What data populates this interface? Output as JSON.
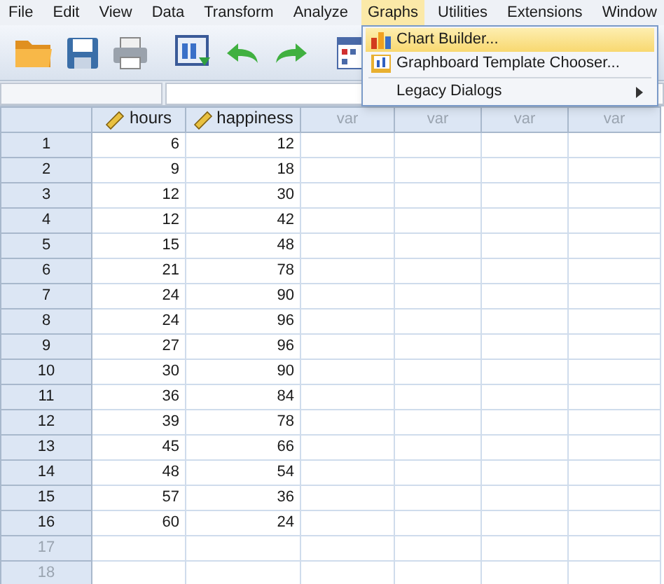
{
  "menu_bar": [
    {
      "label": "File",
      "selected": false
    },
    {
      "label": "Edit",
      "selected": false
    },
    {
      "label": "View",
      "selected": false
    },
    {
      "label": "Data",
      "selected": false
    },
    {
      "label": "Transform",
      "selected": false
    },
    {
      "label": "Analyze",
      "selected": false
    },
    {
      "label": "Graphs",
      "selected": true
    },
    {
      "label": "Utilities",
      "selected": false
    },
    {
      "label": "Extensions",
      "selected": false
    },
    {
      "label": "Window",
      "selected": false
    }
  ],
  "graphs_menu": {
    "items": [
      {
        "label": "Chart Builder...",
        "kind": "chart",
        "selected": true
      },
      {
        "label": "Graphboard Template Chooser...",
        "kind": "graphboard",
        "selected": false
      },
      {
        "label": "Legacy Dialogs",
        "kind": "submenu",
        "selected": false
      }
    ]
  },
  "table": {
    "columns": [
      {
        "label": "hours",
        "kind": "numeric"
      },
      {
        "label": "happiness",
        "kind": "numeric"
      },
      {
        "label": "var",
        "kind": "empty"
      },
      {
        "label": "var",
        "kind": "empty"
      },
      {
        "label": "var",
        "kind": "empty"
      },
      {
        "label": "var",
        "kind": "empty"
      }
    ],
    "rows": [
      {
        "number": "1",
        "in_use": true,
        "cells": [
          "6",
          "12"
        ]
      },
      {
        "number": "2",
        "in_use": true,
        "cells": [
          "9",
          "18"
        ]
      },
      {
        "number": "3",
        "in_use": true,
        "cells": [
          "12",
          "30"
        ]
      },
      {
        "number": "4",
        "in_use": true,
        "cells": [
          "12",
          "42"
        ]
      },
      {
        "number": "5",
        "in_use": true,
        "cells": [
          "15",
          "48"
        ]
      },
      {
        "number": "6",
        "in_use": true,
        "cells": [
          "21",
          "78"
        ]
      },
      {
        "number": "7",
        "in_use": true,
        "cells": [
          "24",
          "90"
        ]
      },
      {
        "number": "8",
        "in_use": true,
        "cells": [
          "24",
          "96"
        ]
      },
      {
        "number": "9",
        "in_use": true,
        "cells": [
          "27",
          "96"
        ]
      },
      {
        "number": "10",
        "in_use": true,
        "cells": [
          "30",
          "90"
        ]
      },
      {
        "number": "11",
        "in_use": true,
        "cells": [
          "36",
          "84"
        ]
      },
      {
        "number": "12",
        "in_use": true,
        "cells": [
          "39",
          "78"
        ]
      },
      {
        "number": "13",
        "in_use": true,
        "cells": [
          "45",
          "66"
        ]
      },
      {
        "number": "14",
        "in_use": true,
        "cells": [
          "48",
          "54"
        ]
      },
      {
        "number": "15",
        "in_use": true,
        "cells": [
          "57",
          "36"
        ]
      },
      {
        "number": "16",
        "in_use": true,
        "cells": [
          "60",
          "24"
        ]
      },
      {
        "number": "17",
        "in_use": false
      },
      {
        "number": "18",
        "in_use": false
      }
    ]
  }
}
